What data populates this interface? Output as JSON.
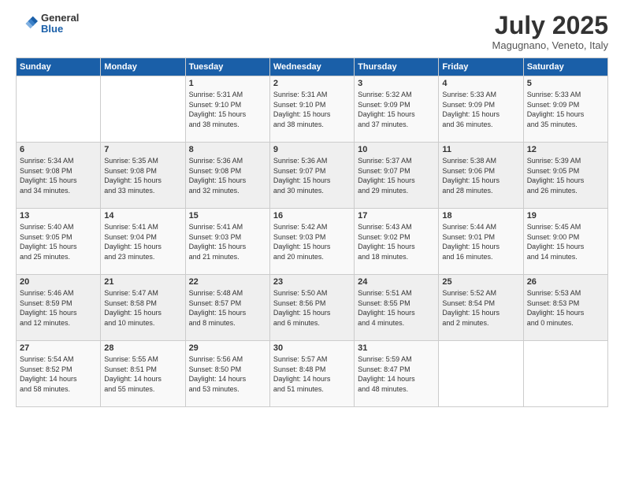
{
  "logo": {
    "general": "General",
    "blue": "Blue"
  },
  "header": {
    "title": "July 2025",
    "location": "Magugnano, Veneto, Italy"
  },
  "days_of_week": [
    "Sunday",
    "Monday",
    "Tuesday",
    "Wednesday",
    "Thursday",
    "Friday",
    "Saturday"
  ],
  "weeks": [
    [
      {
        "day": "",
        "info": ""
      },
      {
        "day": "",
        "info": ""
      },
      {
        "day": "1",
        "info": "Sunrise: 5:31 AM\nSunset: 9:10 PM\nDaylight: 15 hours\nand 38 minutes."
      },
      {
        "day": "2",
        "info": "Sunrise: 5:31 AM\nSunset: 9:10 PM\nDaylight: 15 hours\nand 38 minutes."
      },
      {
        "day": "3",
        "info": "Sunrise: 5:32 AM\nSunset: 9:09 PM\nDaylight: 15 hours\nand 37 minutes."
      },
      {
        "day": "4",
        "info": "Sunrise: 5:33 AM\nSunset: 9:09 PM\nDaylight: 15 hours\nand 36 minutes."
      },
      {
        "day": "5",
        "info": "Sunrise: 5:33 AM\nSunset: 9:09 PM\nDaylight: 15 hours\nand 35 minutes."
      }
    ],
    [
      {
        "day": "6",
        "info": "Sunrise: 5:34 AM\nSunset: 9:08 PM\nDaylight: 15 hours\nand 34 minutes."
      },
      {
        "day": "7",
        "info": "Sunrise: 5:35 AM\nSunset: 9:08 PM\nDaylight: 15 hours\nand 33 minutes."
      },
      {
        "day": "8",
        "info": "Sunrise: 5:36 AM\nSunset: 9:08 PM\nDaylight: 15 hours\nand 32 minutes."
      },
      {
        "day": "9",
        "info": "Sunrise: 5:36 AM\nSunset: 9:07 PM\nDaylight: 15 hours\nand 30 minutes."
      },
      {
        "day": "10",
        "info": "Sunrise: 5:37 AM\nSunset: 9:07 PM\nDaylight: 15 hours\nand 29 minutes."
      },
      {
        "day": "11",
        "info": "Sunrise: 5:38 AM\nSunset: 9:06 PM\nDaylight: 15 hours\nand 28 minutes."
      },
      {
        "day": "12",
        "info": "Sunrise: 5:39 AM\nSunset: 9:05 PM\nDaylight: 15 hours\nand 26 minutes."
      }
    ],
    [
      {
        "day": "13",
        "info": "Sunrise: 5:40 AM\nSunset: 9:05 PM\nDaylight: 15 hours\nand 25 minutes."
      },
      {
        "day": "14",
        "info": "Sunrise: 5:41 AM\nSunset: 9:04 PM\nDaylight: 15 hours\nand 23 minutes."
      },
      {
        "day": "15",
        "info": "Sunrise: 5:41 AM\nSunset: 9:03 PM\nDaylight: 15 hours\nand 21 minutes."
      },
      {
        "day": "16",
        "info": "Sunrise: 5:42 AM\nSunset: 9:03 PM\nDaylight: 15 hours\nand 20 minutes."
      },
      {
        "day": "17",
        "info": "Sunrise: 5:43 AM\nSunset: 9:02 PM\nDaylight: 15 hours\nand 18 minutes."
      },
      {
        "day": "18",
        "info": "Sunrise: 5:44 AM\nSunset: 9:01 PM\nDaylight: 15 hours\nand 16 minutes."
      },
      {
        "day": "19",
        "info": "Sunrise: 5:45 AM\nSunset: 9:00 PM\nDaylight: 15 hours\nand 14 minutes."
      }
    ],
    [
      {
        "day": "20",
        "info": "Sunrise: 5:46 AM\nSunset: 8:59 PM\nDaylight: 15 hours\nand 12 minutes."
      },
      {
        "day": "21",
        "info": "Sunrise: 5:47 AM\nSunset: 8:58 PM\nDaylight: 15 hours\nand 10 minutes."
      },
      {
        "day": "22",
        "info": "Sunrise: 5:48 AM\nSunset: 8:57 PM\nDaylight: 15 hours\nand 8 minutes."
      },
      {
        "day": "23",
        "info": "Sunrise: 5:50 AM\nSunset: 8:56 PM\nDaylight: 15 hours\nand 6 minutes."
      },
      {
        "day": "24",
        "info": "Sunrise: 5:51 AM\nSunset: 8:55 PM\nDaylight: 15 hours\nand 4 minutes."
      },
      {
        "day": "25",
        "info": "Sunrise: 5:52 AM\nSunset: 8:54 PM\nDaylight: 15 hours\nand 2 minutes."
      },
      {
        "day": "26",
        "info": "Sunrise: 5:53 AM\nSunset: 8:53 PM\nDaylight: 15 hours\nand 0 minutes."
      }
    ],
    [
      {
        "day": "27",
        "info": "Sunrise: 5:54 AM\nSunset: 8:52 PM\nDaylight: 14 hours\nand 58 minutes."
      },
      {
        "day": "28",
        "info": "Sunrise: 5:55 AM\nSunset: 8:51 PM\nDaylight: 14 hours\nand 55 minutes."
      },
      {
        "day": "29",
        "info": "Sunrise: 5:56 AM\nSunset: 8:50 PM\nDaylight: 14 hours\nand 53 minutes."
      },
      {
        "day": "30",
        "info": "Sunrise: 5:57 AM\nSunset: 8:48 PM\nDaylight: 14 hours\nand 51 minutes."
      },
      {
        "day": "31",
        "info": "Sunrise: 5:59 AM\nSunset: 8:47 PM\nDaylight: 14 hours\nand 48 minutes."
      },
      {
        "day": "",
        "info": ""
      },
      {
        "day": "",
        "info": ""
      }
    ]
  ]
}
